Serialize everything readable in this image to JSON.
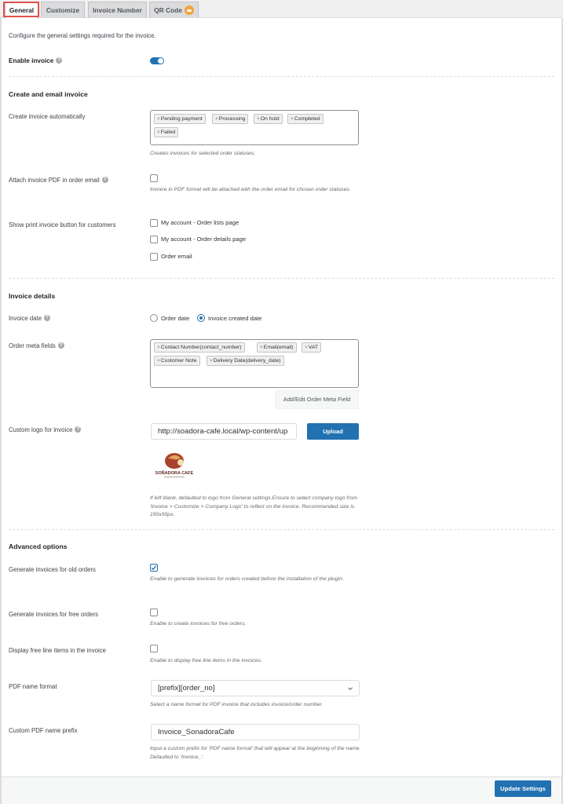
{
  "tabs": [
    {
      "label": "General",
      "active": true
    },
    {
      "label": "Customize",
      "active": false
    },
    {
      "label": "Invoice Number",
      "active": false
    },
    {
      "label": "QR Code",
      "active": false,
      "badge": "crown-icon"
    }
  ],
  "intro": "Configure the general settings required for the invoice.",
  "enable_invoice": {
    "label": "Enable invoice",
    "enabled": true
  },
  "create_email": {
    "title": "Create and email invoice",
    "auto_create": {
      "label": "Create invoice automatically",
      "chips": [
        "Pending payment",
        "Processing",
        "On hold",
        "Completed",
        "Failed"
      ],
      "help": "Creates invoices for selected order statuses."
    },
    "attach_pdf": {
      "label": "Attach invoice PDF in order email",
      "checked": false,
      "help": "Invoice in PDF format will be attached with the order email for chosen order statuses."
    },
    "print_button": {
      "label": "Show print invoice button for customers",
      "options": [
        {
          "label": "My account - Order lists page",
          "checked": false
        },
        {
          "label": "My account - Order details page",
          "checked": false
        },
        {
          "label": "Order email",
          "checked": false
        }
      ]
    }
  },
  "invoice_details": {
    "title": "Invoice details",
    "invoice_date": {
      "label": "Invoice date",
      "options": [
        {
          "label": "Order date",
          "selected": false
        },
        {
          "label": "Invoice created date",
          "selected": true
        }
      ]
    },
    "meta_fields": {
      "label": "Order meta fields",
      "chips": [
        "Contact Number(contact_number)",
        "Email(email)",
        "VAT",
        "Customer Note",
        "Delivery Date(delivery_date)"
      ],
      "button": "Add/Edit Order Meta Field"
    },
    "custom_logo": {
      "label": "Custom logo for invoice",
      "value": "http://soadora-cafe.local/wp-content/up",
      "upload": "Upload",
      "logo_text": "SOÑADORA CAFE",
      "help": "If left blank, defaulted to logo from General settings.Ensure to select company logo from 'Invoice > Customize > Company Logo' to reflect on the invoice. Recommended size is 150x50px."
    }
  },
  "advanced": {
    "title": "Advanced options",
    "old_orders": {
      "label": "Generate invoices for old orders",
      "checked": true,
      "help": "Enable to generate invoices for orders created before the installation of the plugin."
    },
    "free_orders": {
      "label": "Generate invoices for free orders",
      "checked": false,
      "help": "Enable to create invoices for free orders."
    },
    "free_items": {
      "label": "Display free line items in the invoice",
      "checked": false,
      "help": "Enable to display free line items in the invoices."
    },
    "pdf_format": {
      "label": "PDF name format",
      "value": "[prefix][order_no]",
      "help": "Select a name format for PDF invoice that includes invoice/order number."
    },
    "pdf_prefix": {
      "label": "Custom PDF name prefix",
      "value": "Invoice_SonadoraCafe",
      "help": "Input a custom prefix for 'PDF name format' that will appear at the beginning of the name. Defaulted to 'Invoice_'."
    }
  },
  "footer": {
    "update_button": "Update Settings"
  },
  "colors": {
    "accent": "#2271b1",
    "highlight": "#e0504a",
    "crown": "#f2a33a"
  }
}
